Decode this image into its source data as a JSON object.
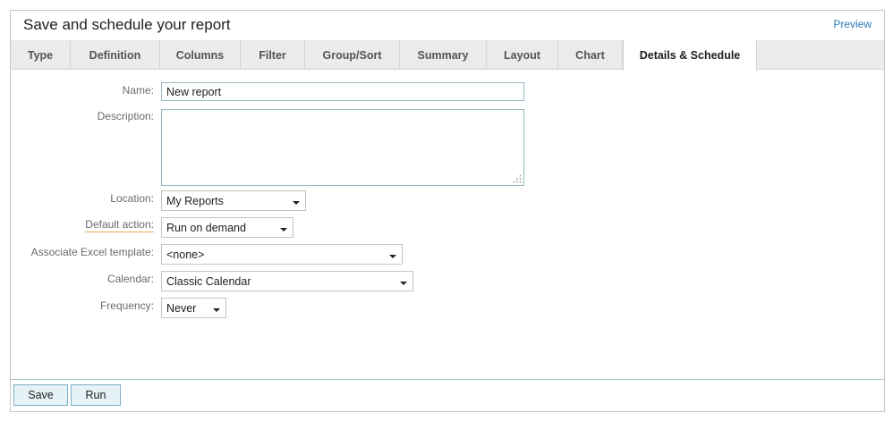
{
  "header": {
    "title": "Save and schedule your report",
    "preview_link": "Preview"
  },
  "tabs": [
    {
      "label": "Type"
    },
    {
      "label": "Definition"
    },
    {
      "label": "Columns"
    },
    {
      "label": "Filter"
    },
    {
      "label": "Group/Sort"
    },
    {
      "label": "Summary"
    },
    {
      "label": "Layout"
    },
    {
      "label": "Chart"
    },
    {
      "label": "Details & Schedule",
      "active": true
    }
  ],
  "form": {
    "name_label": "Name:",
    "name_value": "New report",
    "description_label": "Description:",
    "description_value": "",
    "location_label": "Location:",
    "location_value": "My Reports",
    "default_action_label": "Default action:",
    "default_action_value": "Run on demand",
    "excel_template_label": "Associate Excel template:",
    "excel_template_value": "<none>",
    "calendar_label": "Calendar:",
    "calendar_value": "Classic Calendar",
    "frequency_label": "Frequency:",
    "frequency_value": "Never"
  },
  "footer": {
    "save_label": "Save",
    "run_label": "Run"
  },
  "colors": {
    "link": "#2c78b4",
    "tab_bar": "#ebebeb",
    "button_bg": "#e5f3f8",
    "button_border": "#7fb0c3",
    "input_border": "#9ab7c2"
  }
}
